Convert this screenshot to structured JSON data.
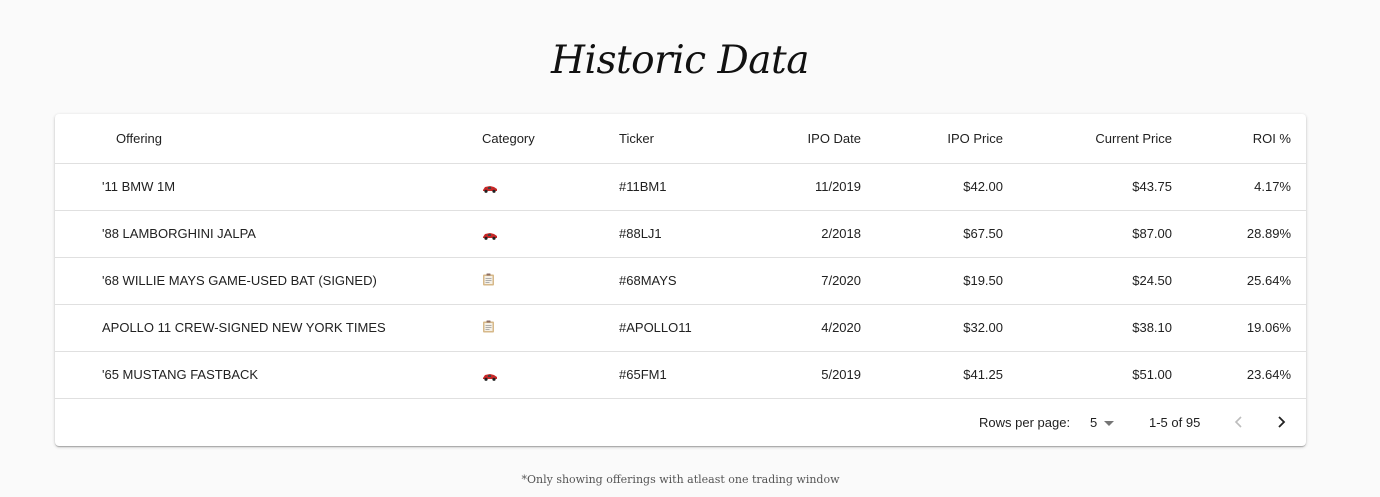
{
  "page": {
    "title": "Historic Data",
    "footnote": "*Only showing offerings with atleast one trading window"
  },
  "table": {
    "columns": {
      "offering": "Offering",
      "category": "Category",
      "ticker": "Ticker",
      "ipo_date": "IPO Date",
      "ipo_price": "IPO Price",
      "current_price": "Current Price",
      "roi": "ROI %"
    },
    "rows": [
      {
        "offering": "'11 BMW 1M",
        "category_icon": "race-car-icon",
        "ticker": "#11BM1",
        "ipo_date": "11/2019",
        "ipo_price": "$42.00",
        "current_price": "$43.75",
        "roi": "4.17%"
      },
      {
        "offering": "'88 LAMBORGHINI JALPA",
        "category_icon": "race-car-icon",
        "ticker": "#88LJ1",
        "ipo_date": "2/2018",
        "ipo_price": "$67.50",
        "current_price": "$87.00",
        "roi": "28.89%"
      },
      {
        "offering": "'68 WILLIE MAYS GAME-USED BAT (SIGNED)",
        "category_icon": "memorabilia-icon",
        "ticker": "#68MAYS",
        "ipo_date": "7/2020",
        "ipo_price": "$19.50",
        "current_price": "$24.50",
        "roi": "25.64%"
      },
      {
        "offering": "APOLLO 11 CREW-SIGNED NEW YORK TIMES",
        "category_icon": "memorabilia-icon",
        "ticker": "#APOLLO11",
        "ipo_date": "4/2020",
        "ipo_price": "$32.00",
        "current_price": "$38.10",
        "roi": "19.06%"
      },
      {
        "offering": "'65 MUSTANG FASTBACK",
        "category_icon": "race-car-icon",
        "ticker": "#65FM1",
        "ipo_date": "5/2019",
        "ipo_price": "$41.25",
        "current_price": "$51.00",
        "roi": "23.64%"
      }
    ]
  },
  "pagination": {
    "rows_per_page_label": "Rows per page:",
    "rows_per_page_value": "5",
    "range_label": "1-5 of 95",
    "prev_icon": "chevron-left-icon",
    "next_icon": "chevron-right-icon"
  },
  "colors": {
    "background": "#fafafa",
    "card": "#ffffff",
    "divider": "#e0e0e0",
    "car_red": "#c62828"
  }
}
